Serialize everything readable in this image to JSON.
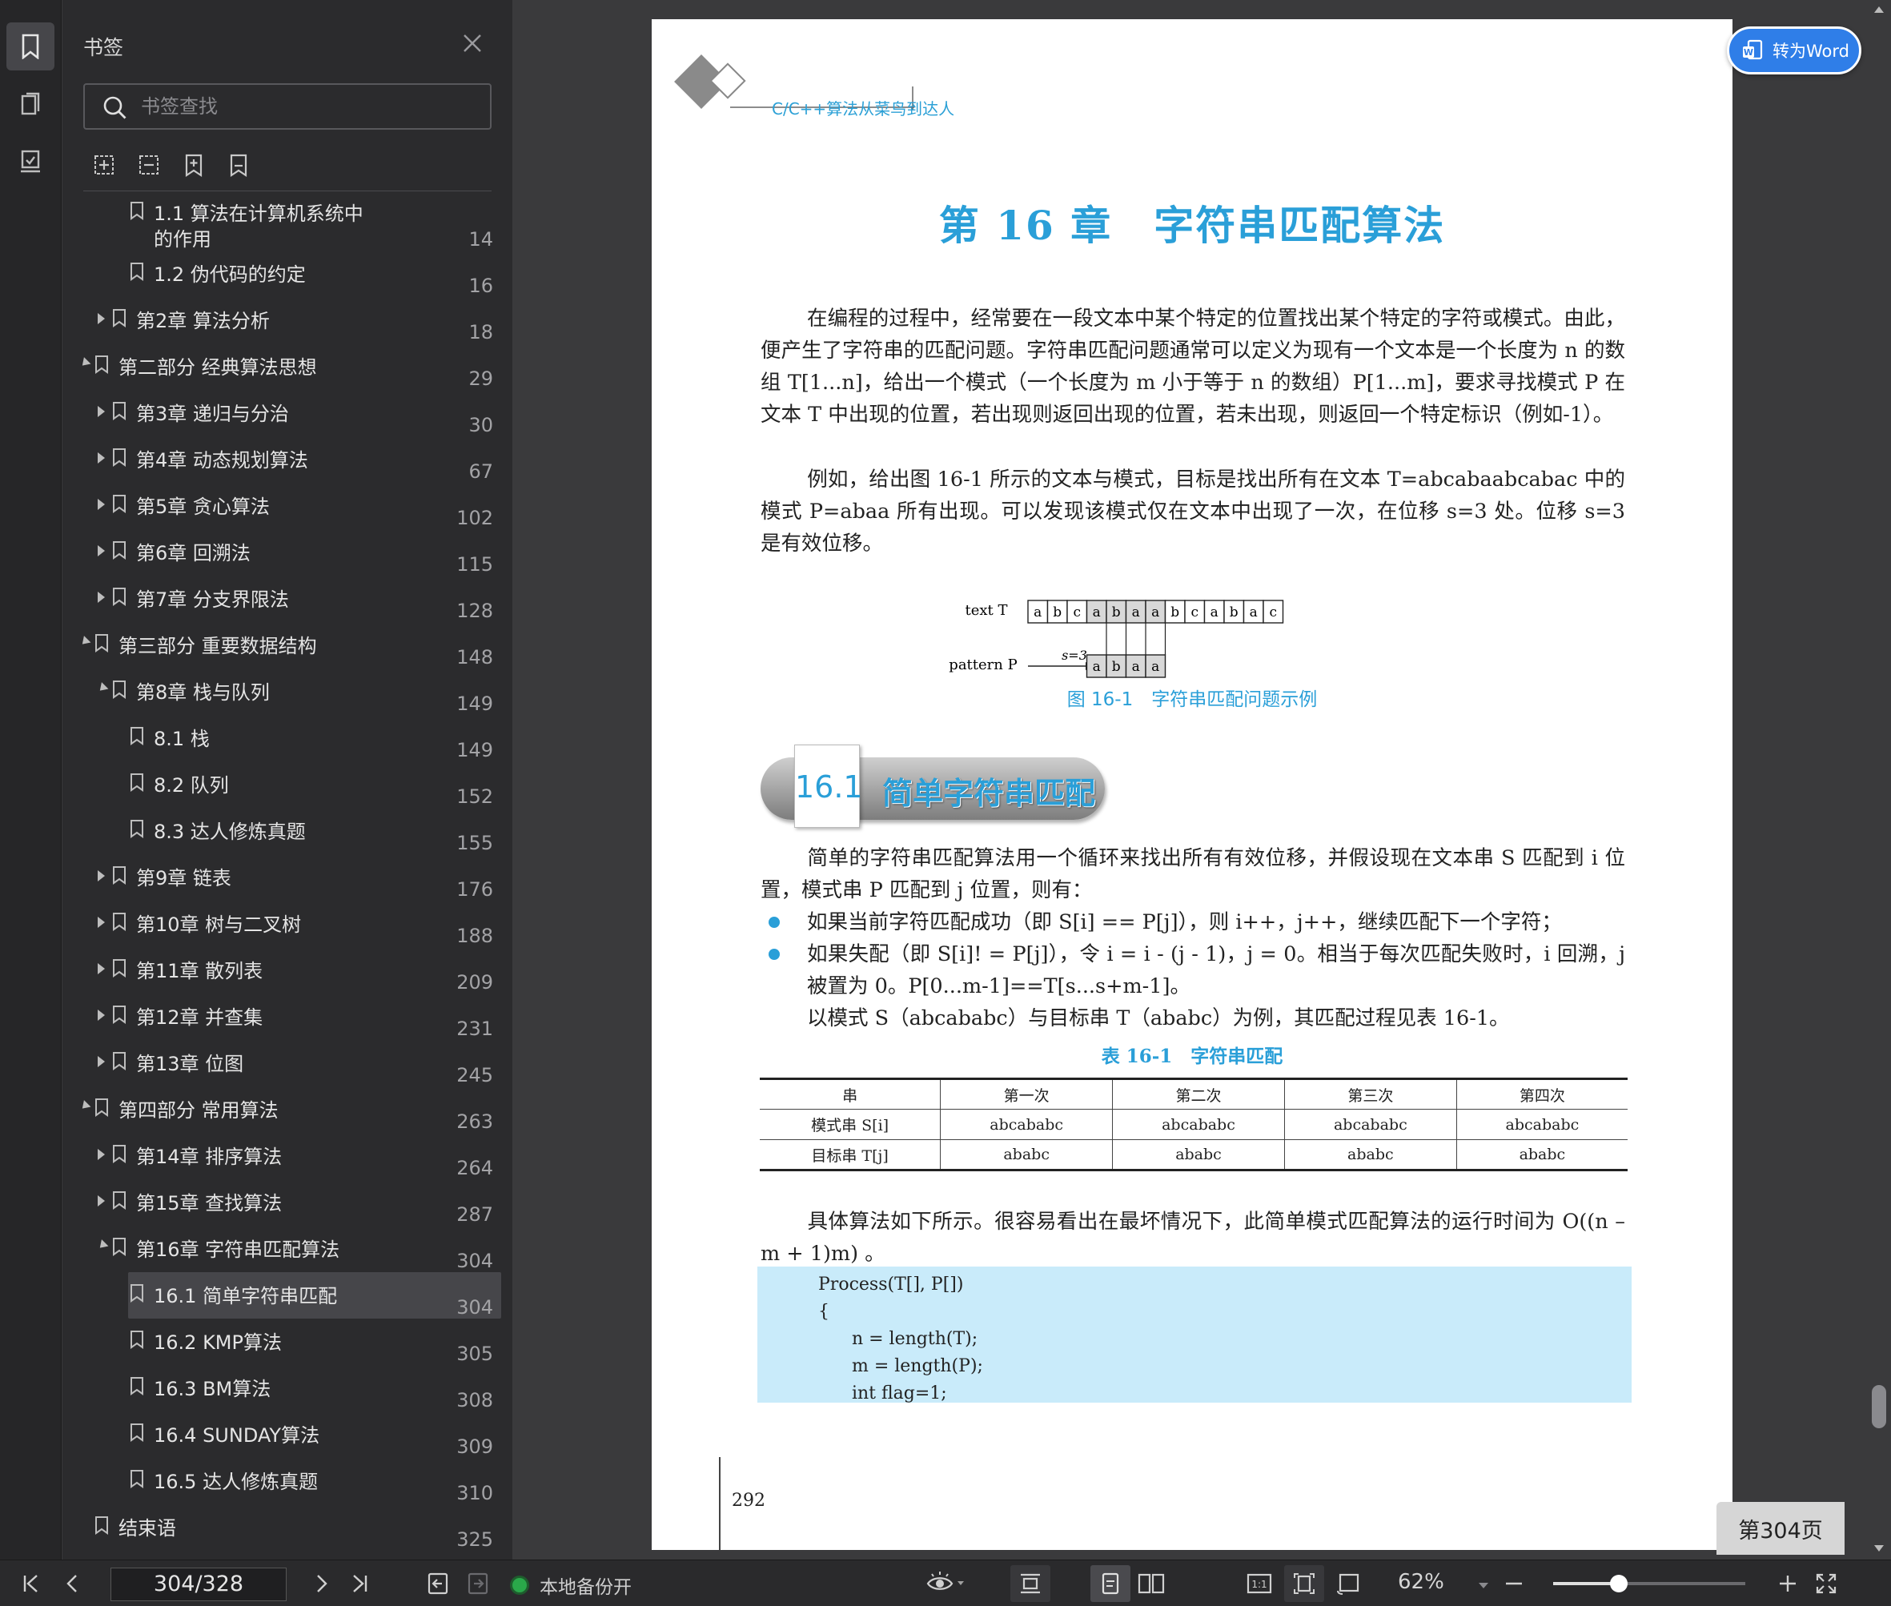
{
  "sidebar": {
    "title": "书签",
    "search_placeholder": "书签查找",
    "items": [
      {
        "label": "1.1 算法在计算机系统中",
        "label2": "的作用",
        "page": "14",
        "level": 2,
        "expander": "none"
      },
      {
        "label": "1.2 伪代码的约定",
        "page": "16",
        "level": 2,
        "expander": "none"
      },
      {
        "label": "第2章 算法分析",
        "page": "18",
        "level": 1,
        "expander": "collapsed"
      },
      {
        "label": "第二部分 经典算法思想",
        "page": "29",
        "level": 0,
        "expander": "expanded"
      },
      {
        "label": "第3章 递归与分治",
        "page": "30",
        "level": 1,
        "expander": "collapsed"
      },
      {
        "label": "第4章 动态规划算法",
        "page": "67",
        "level": 1,
        "expander": "collapsed"
      },
      {
        "label": "第5章 贪心算法",
        "page": "102",
        "level": 1,
        "expander": "collapsed"
      },
      {
        "label": "第6章 回溯法",
        "page": "115",
        "level": 1,
        "expander": "collapsed"
      },
      {
        "label": "第7章 分支界限法",
        "page": "128",
        "level": 1,
        "expander": "collapsed"
      },
      {
        "label": "第三部分 重要数据结构",
        "page": "148",
        "level": 0,
        "expander": "expanded"
      },
      {
        "label": "第8章 栈与队列",
        "page": "149",
        "level": 1,
        "expander": "expanded"
      },
      {
        "label": "8.1 栈",
        "page": "149",
        "level": 2,
        "expander": "none"
      },
      {
        "label": "8.2 队列",
        "page": "152",
        "level": 2,
        "expander": "none"
      },
      {
        "label": "8.3 达人修炼真题",
        "page": "155",
        "level": 2,
        "expander": "none"
      },
      {
        "label": "第9章 链表",
        "page": "176",
        "level": 1,
        "expander": "collapsed"
      },
      {
        "label": "第10章 树与二叉树",
        "page": "188",
        "level": 1,
        "expander": "collapsed"
      },
      {
        "label": "第11章 散列表",
        "page": "209",
        "level": 1,
        "expander": "collapsed"
      },
      {
        "label": "第12章 并查集",
        "page": "231",
        "level": 1,
        "expander": "collapsed"
      },
      {
        "label": "第13章 位图",
        "page": "245",
        "level": 1,
        "expander": "collapsed"
      },
      {
        "label": "第四部分 常用算法",
        "page": "263",
        "level": 0,
        "expander": "expanded"
      },
      {
        "label": "第14章 排序算法",
        "page": "264",
        "level": 1,
        "expander": "collapsed"
      },
      {
        "label": "第15章 查找算法",
        "page": "287",
        "level": 1,
        "expander": "collapsed"
      },
      {
        "label": "第16章 字符串匹配算法",
        "page": "304",
        "level": 1,
        "expander": "expanded"
      },
      {
        "label": "16.1 简单字符串匹配",
        "page": "304",
        "level": 2,
        "expander": "none",
        "selected": true
      },
      {
        "label": "16.2 KMP算法",
        "page": "305",
        "level": 2,
        "expander": "none"
      },
      {
        "label": "16.3 BM算法",
        "page": "308",
        "level": 2,
        "expander": "none"
      },
      {
        "label": "16.4 SUNDAY算法",
        "page": "309",
        "level": 2,
        "expander": "none"
      },
      {
        "label": "16.5 达人修炼真题",
        "page": "310",
        "level": 2,
        "expander": "none"
      },
      {
        "label": "结束语",
        "page": "325",
        "level": 0,
        "expander": "none"
      }
    ]
  },
  "document": {
    "header": "C/C++算法从菜鸟到达人",
    "chapter_title": "第 16 章　字符串匹配算法",
    "intro_p1": "在编程的过程中，经常要在一段文本中某个特定的位置找出某个特定的字符或模式。由此，便产生了字符串的匹配问题。字符串匹配问题通常可以定义为现有一个文本是一个长度为 n 的数组 T[1...n]，给出一个模式（一个长度为 m 小于等于 n 的数组）P[1...m]，要求寻找模式 P 在文本 T 中出现的位置，若出现则返回出现的位置，若未出现，则返回一个特定标识（例如-1）。",
    "intro_p2": "例如，给出图 16-1 所示的文本与模式，目标是找出所有在文本 T=abcabaabcabac 中的模式 P=abaa 所有出现。可以发现该模式仅在文本中出现了一次，在位移 s=3 处。位移 s=3 是有效位移。",
    "figure": {
      "text_label": "text T",
      "text_cells": [
        "a",
        "b",
        "c",
        "a",
        "b",
        "a",
        "a",
        "b",
        "c",
        "a",
        "b",
        "a",
        "c"
      ],
      "pattern_label": "pattern P",
      "shift_label": "s=3",
      "pattern_cells": [
        "a",
        "b",
        "a",
        "a"
      ],
      "caption": "图 16-1　字符串匹配问题示例"
    },
    "section_number": "16.1",
    "section_title": "简单字符串匹配",
    "sec_p1": "简单的字符串匹配算法用一个循环来找出所有有效位移，并假设现在文本串 S 匹配到 i 位置，模式串 P 匹配到 j 位置，则有：",
    "bullet1": "如果当前字符匹配成功（即 S[i] == P[j]），则 i++，j++，继续匹配下一个字符；",
    "bullet2": "如果失配（即 S[i]! = P[j]），令 i = i - (j - 1)，j = 0。相当于每次匹配失败时，i 回溯，j 被置为 0。P[0...m-1]==T[s...s+m-1]。",
    "sec_p2": "以模式 S（abcababc）与目标串 T（ababc）为例，其匹配过程见表 16-1。",
    "table_caption": "表 16-1　字符串匹配",
    "table_headers": [
      "串",
      "第一次",
      "第二次",
      "第三次",
      "第四次"
    ],
    "table_rows": [
      [
        "模式串 S[i]",
        "abcababc",
        "abcababc",
        "abcababc",
        "abcababc"
      ],
      [
        "目标串 T[j]",
        "ababc",
        "ababc",
        "ababc",
        "ababc"
      ]
    ],
    "sec_p3": "具体算法如下所示。很容易看出在最坏情况下，此简单模式匹配算法的运行时间为 O((n – m + 1)m) 。",
    "code_lines": [
      "Process(T[], P[])",
      "{",
      "      n = length(T);",
      "      m = length(P);",
      "      int flag=1;"
    ],
    "page_number": "292"
  },
  "to_word_label": "转为Word",
  "page_badge": "第304页",
  "status": {
    "page_field": "304/328",
    "backup_label": "本地备份开",
    "zoom_label": "62%",
    "zoom_fraction": 0.34
  }
}
